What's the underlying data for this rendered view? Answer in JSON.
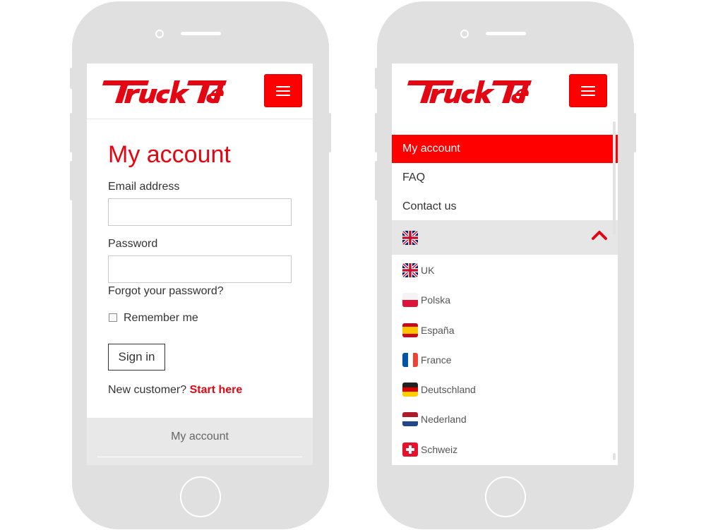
{
  "brand": {
    "logo_text": "TruckTel",
    "accent": "#ff0000",
    "title_color": "#e30613"
  },
  "login": {
    "title": "My account",
    "email_label": "Email address",
    "email_value": "",
    "password_label": "Password",
    "password_value": "",
    "forgot_link": "Forgot your password?",
    "remember_label": "Remember me",
    "remember_checked": false,
    "signin_label": "Sign in",
    "new_customer_text": "New customer?",
    "start_here_link": "Start here",
    "footer_link": "My account"
  },
  "menu": {
    "items": [
      {
        "label": "My account",
        "active": true
      },
      {
        "label": "FAQ",
        "active": false
      },
      {
        "label": "Contact us",
        "active": false
      }
    ],
    "current_language_flag": "uk-flag-icon",
    "languages": [
      {
        "label": "UK",
        "flag": "uk-flag-icon"
      },
      {
        "label": "Polska",
        "flag": "poland-flag-icon"
      },
      {
        "label": "España",
        "flag": "spain-flag-icon"
      },
      {
        "label": "France",
        "flag": "france-flag-icon"
      },
      {
        "label": "Deutschland",
        "flag": "germany-flag-icon"
      },
      {
        "label": "Nederland",
        "flag": "netherlands-flag-icon"
      },
      {
        "label": "Schweiz",
        "flag": "switzerland-flag-icon"
      }
    ]
  },
  "icons": {
    "menu": "hamburger-menu-icon",
    "collapse": "chevron-up-icon"
  }
}
